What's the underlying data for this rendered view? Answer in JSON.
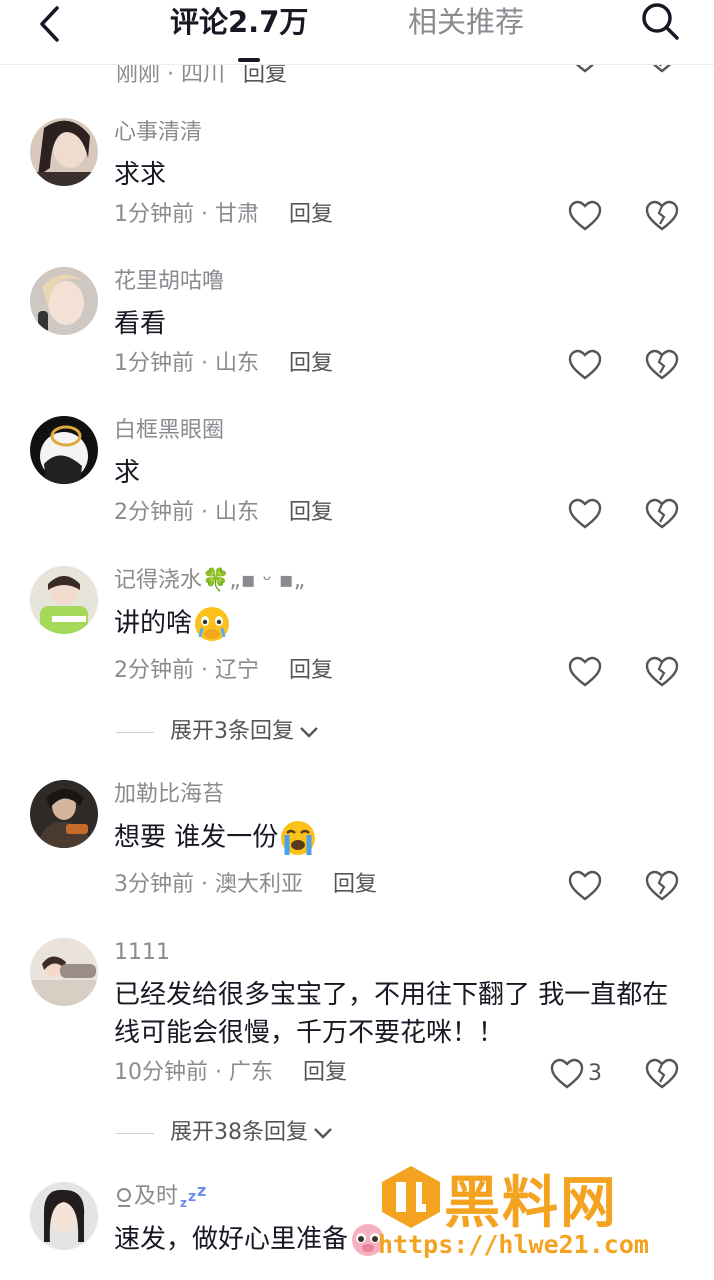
{
  "header": {
    "tab_comments": "评论2.7万",
    "tab_related": "相关推荐"
  },
  "partial": {
    "meta": "刚刚 · 四川",
    "reply": "回复"
  },
  "comments": [
    {
      "author": "心事清清",
      "text": "求求",
      "time": "1分钟前",
      "location": "甘肃",
      "reply": "回复"
    },
    {
      "author": "花里胡咕噜",
      "text": "看看",
      "time": "1分钟前",
      "location": "山东",
      "reply": "回复"
    },
    {
      "author": "白框黑眼圈",
      "text": "求",
      "time": "2分钟前",
      "location": "山东",
      "reply": "回复"
    },
    {
      "author": "记得浇水🍀„▪ ᵕ ▪„",
      "text": "讲的啥",
      "time": "2分钟前",
      "location": "辽宁",
      "reply": "回复",
      "expand": "展开3条回复"
    },
    {
      "author": "加勒比海苔",
      "text": "想要 谁发一份",
      "time": "3分钟前",
      "location": "澳大利亚",
      "reply": "回复"
    },
    {
      "author": "1111",
      "text": "已经发给很多宝宝了，不用往下翻了 我一直都在线可能会很慢，千万不要花咪！！",
      "time": "10分钟前",
      "location": "广东",
      "reply": "回复",
      "likes": "3",
      "expand": "展开38条回复"
    },
    {
      "author": "及时",
      "text": "速发，做好心里准备",
      "time": "",
      "location": "",
      "reply": ""
    }
  ],
  "watermark": {
    "title": "黑料网",
    "url": "https://hlwe21.com"
  },
  "colors": {
    "text_primary": "#161823",
    "text_secondary": "#8a8b91",
    "watermark": "#f4a321"
  }
}
